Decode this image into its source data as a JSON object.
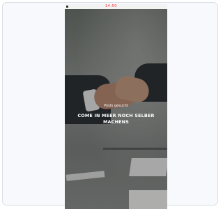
{
  "status_bar": {
    "center_text": "14:50"
  },
  "hero": {
    "subtitle": "Posts gesucht",
    "title": "COME IN MEER NOCH SELBER MACHENS"
  },
  "colors": {
    "frame_border": "#d9dee5",
    "frame_bg": "#f7f9fc",
    "status_red": "#ff3030"
  }
}
